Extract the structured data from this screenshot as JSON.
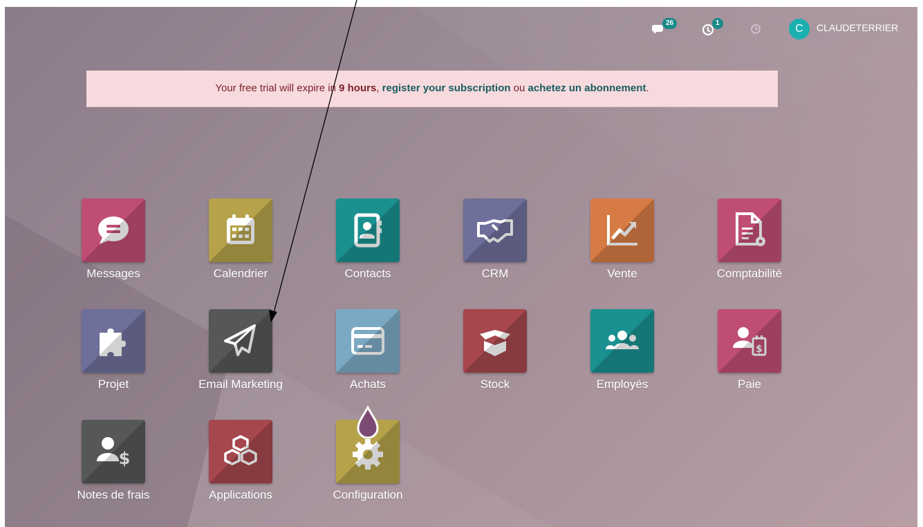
{
  "topbar": {
    "messages_badge": "26",
    "activity_badge": "1",
    "avatar_initial": "C",
    "username": "CLAUDETERRIER",
    "icons": [
      "chat-icon",
      "activity-icon",
      "clock-icon"
    ]
  },
  "banner": {
    "text_before": "Your free trial will expire in ",
    "hours": "9 hours",
    "sep": ", ",
    "register_link": "register your subscription",
    "or": " ou ",
    "buy_link": "achetez un abonnement",
    "end": "."
  },
  "apps": [
    {
      "label": "Messages",
      "icon": "chat-bubble-icon",
      "color": "#c04d73"
    },
    {
      "label": "Calendrier",
      "icon": "calendar-icon",
      "color": "#b5a24a"
    },
    {
      "label": "Contacts",
      "icon": "address-book-icon",
      "color": "#1a9090"
    },
    {
      "label": "CRM",
      "icon": "handshake-icon",
      "color": "#6e6f9a"
    },
    {
      "label": "Vente",
      "icon": "line-chart-icon",
      "color": "#d77b44"
    },
    {
      "label": "Comptabilité",
      "icon": "invoice-gear-icon",
      "color": "#c04d73"
    },
    {
      "label": "Projet",
      "icon": "puzzle-icon",
      "color": "#6e6f9a"
    },
    {
      "label": "Email Marketing",
      "icon": "paper-plane-icon",
      "color": "#555857"
    },
    {
      "label": "Achats",
      "icon": "credit-card-icon",
      "color": "#7ba9c4"
    },
    {
      "label": "Stock",
      "icon": "open-box-icon",
      "color": "#a5474d"
    },
    {
      "label": "Employés",
      "icon": "users-icon",
      "color": "#1a9090"
    },
    {
      "label": "Paie",
      "icon": "user-payslip-icon",
      "color": "#c04d73"
    },
    {
      "label": "Notes de frais",
      "icon": "user-dollar-icon",
      "color": "#555857"
    },
    {
      "label": "Applications",
      "icon": "cubes-icon",
      "color": "#a5474d"
    },
    {
      "label": "Configuration",
      "icon": "gear-drop-icon",
      "color": "#b5a24a"
    }
  ]
}
